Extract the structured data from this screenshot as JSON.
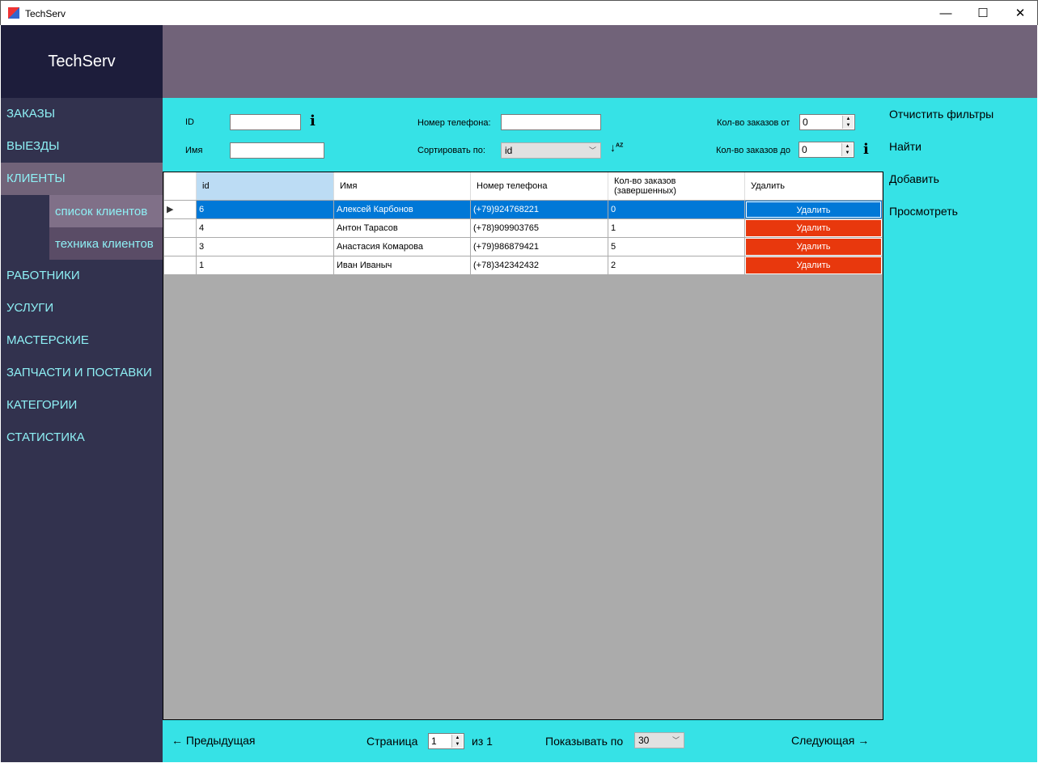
{
  "window": {
    "title": "TechServ",
    "minimize": "—",
    "maximize": "☐",
    "close": "✕"
  },
  "app": {
    "logo": "TechServ"
  },
  "sidebar": {
    "items": [
      {
        "label": "ЗАКАЗЫ"
      },
      {
        "label": "ВЫЕЗДЫ"
      },
      {
        "label": "КЛИЕНТЫ",
        "selected": true
      },
      {
        "label": "РАБОТНИКИ"
      },
      {
        "label": "УСЛУГИ"
      },
      {
        "label": "МАСТЕРСКИЕ"
      },
      {
        "label": "ЗАПЧАСТИ И ПОСТАВКИ"
      },
      {
        "label": "КАТЕГОРИИ"
      },
      {
        "label": "СТАТИСТИКА"
      }
    ],
    "subitems": [
      {
        "label": "список клиентов",
        "selected": true
      },
      {
        "label": "техника клиентов"
      }
    ]
  },
  "filters": {
    "id_label": "ID",
    "id_value": "",
    "name_label": "Имя",
    "name_value": "",
    "phone_label": "Номер телефона:",
    "phone_value": "",
    "sort_label": "Сортировать по:",
    "sort_value": "id",
    "orders_from_label": "Кол-во заказов от",
    "orders_from_value": "0",
    "orders_to_label": "Кол-во заказов до",
    "orders_to_value": "0"
  },
  "actions": {
    "clear": "Отчистить фильтры",
    "find": "Найти",
    "add": "Добавить",
    "view": "Просмотреть"
  },
  "table": {
    "columns": [
      "id",
      "Имя",
      "Номер телефона",
      "Кол-во заказов\n(завершенных)",
      "Удалить"
    ],
    "rows": [
      {
        "id": "6",
        "name": "Алексей Карбонов",
        "phone": "(+79)924768221",
        "orders": "0",
        "delete": "Удалить",
        "selected": true
      },
      {
        "id": "4",
        "name": "Антон Тарасов",
        "phone": "(+78)909903765",
        "orders": "1",
        "delete": "Удалить"
      },
      {
        "id": "3",
        "name": "Анастасия Комарова",
        "phone": "(+79)986879421",
        "orders": "5",
        "delete": "Удалить"
      },
      {
        "id": "1",
        "name": "Иван Иваныч",
        "phone": "(+78)342342432",
        "orders": "2",
        "delete": "Удалить"
      }
    ]
  },
  "pager": {
    "prev": "← Предыдущая",
    "page_label": "Страница",
    "page_value": "1",
    "of": "из 1",
    "per_page_label": "Показывать по",
    "per_page_value": "30",
    "next": "Следующая →"
  },
  "colors": {
    "sidebar": "#32324e",
    "logo_bg": "#1d1d3b",
    "topbar": "#716379",
    "main": "#36e2e6",
    "delete": "#e8380d",
    "selection": "#0078d7"
  }
}
